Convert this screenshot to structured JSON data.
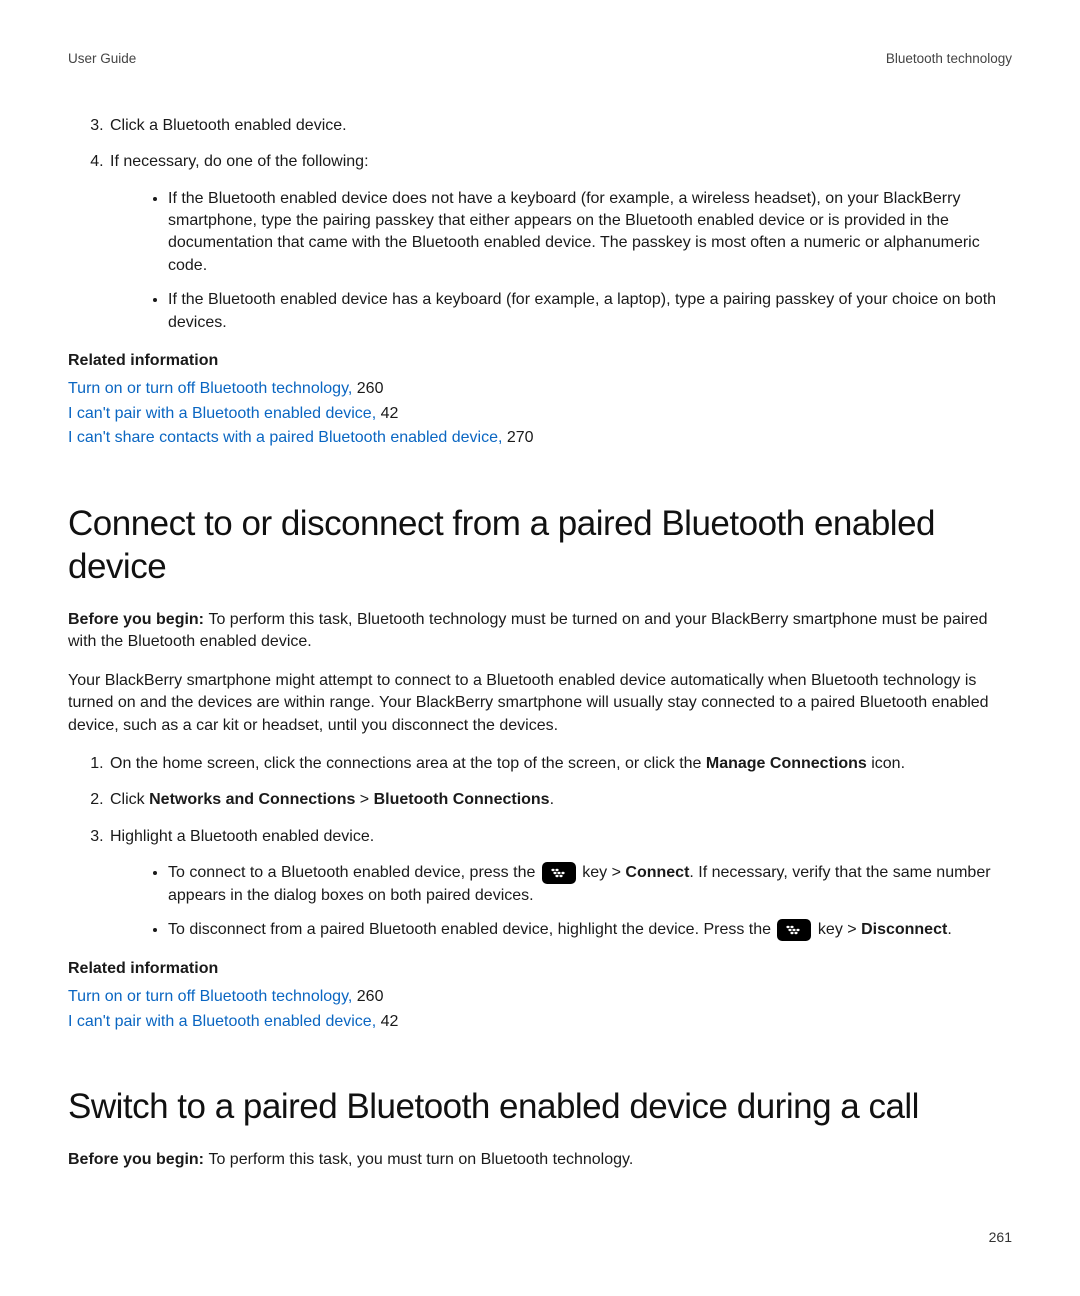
{
  "header": {
    "left": "User Guide",
    "right": "Bluetooth technology"
  },
  "top_ol": {
    "start": 3,
    "items": [
      {
        "text": "Click a Bluetooth enabled device."
      },
      {
        "text": "If necessary, do one of the following:",
        "bullets": [
          "If the Bluetooth enabled device does not have a keyboard (for example, a wireless headset), on your BlackBerry smartphone, type the pairing passkey that either appears on the Bluetooth enabled device or is provided in the documentation that came with the Bluetooth enabled device. The passkey is most often a numeric or alphanumeric code.",
          "If the Bluetooth enabled device has a keyboard (for example, a laptop), type a pairing passkey of your choice on both devices."
        ]
      }
    ]
  },
  "related_heading": "Related information",
  "related1": [
    {
      "link": "Turn on or turn off Bluetooth technology,",
      "suffix": " 260"
    },
    {
      "link": "I can't pair with a Bluetooth enabled device,",
      "suffix": " 42"
    },
    {
      "link": "I can't share contacts with a paired Bluetooth enabled device,",
      "suffix": " 270"
    }
  ],
  "section1": {
    "title": "Connect to or disconnect from a paired Bluetooth enabled device",
    "before_label": "Before you begin: ",
    "before_text": "To perform this task, Bluetooth technology must be turned on and your BlackBerry smartphone must be paired with the Bluetooth enabled device.",
    "para2": "Your BlackBerry smartphone might attempt to connect to a Bluetooth enabled device automatically when Bluetooth technology is turned on and the devices are within range. Your BlackBerry smartphone will usually stay connected to a paired Bluetooth enabled device, such as a car kit or headset, until you disconnect the devices.",
    "ol": {
      "item1_pre": "On the home screen, click the connections area at the top of the screen, or click the ",
      "item1_bold": "Manage Connections",
      "item1_post": " icon.",
      "item2_pre": "Click ",
      "item2_bold1": "Networks and Connections",
      "item2_sep": " > ",
      "item2_bold2": "Bluetooth Connections",
      "item2_post": ".",
      "item3": "Highlight a Bluetooth enabled device.",
      "bullets": {
        "b1_a": "To connect to a Bluetooth enabled device, press the ",
        "b1_b": " key > ",
        "b1_bold": "Connect",
        "b1_c": ". If necessary, verify that the same number appears in the dialog boxes on both paired devices.",
        "b2_a": "To disconnect from a paired Bluetooth enabled device, highlight the device. Press the ",
        "b2_b": " key > ",
        "b2_bold": "Disconnect",
        "b2_c": "."
      }
    }
  },
  "related2": [
    {
      "link": "Turn on or turn off Bluetooth technology,",
      "suffix": " 260"
    },
    {
      "link": "I can't pair with a Bluetooth enabled device,",
      "suffix": " 42"
    }
  ],
  "section2": {
    "title": "Switch to a paired Bluetooth enabled device during a call",
    "before_label": "Before you begin: ",
    "before_text": "To perform this task, you must turn on Bluetooth technology."
  },
  "page_number": "261"
}
